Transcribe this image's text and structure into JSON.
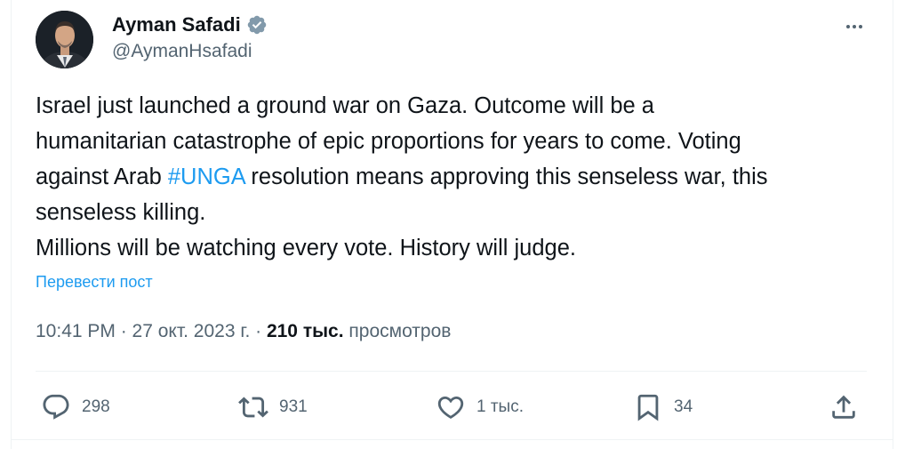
{
  "author": {
    "display_name": "Ayman Safadi",
    "handle": "@AymanHsafadi",
    "verified": true
  },
  "tweet": {
    "lines": [
      "Israel just launched a ground war on Gaza. Outcome will be a",
      "humanitarian catastrophe of epic proportions for years to come. Voting",
      "against Arab ",
      "#UNGA",
      " resolution means approving this senseless war, this",
      "senseless killing.",
      "Millions will be watching every vote. History will judge."
    ]
  },
  "translate_label": "Перевести пост",
  "meta": {
    "timestamp": "10:41 PM · 27 окт. 2023 г. · ",
    "views_count": "210 тыс.",
    "views_label": " просмотров"
  },
  "actions": {
    "reply_count": "298",
    "repost_count": "931",
    "like_count": "1 тыс.",
    "bookmark_count": "34"
  },
  "colors": {
    "accent": "#1d9bf0",
    "secondary_text": "#536471",
    "primary_text": "#0f1419",
    "verified": "#829aab"
  }
}
